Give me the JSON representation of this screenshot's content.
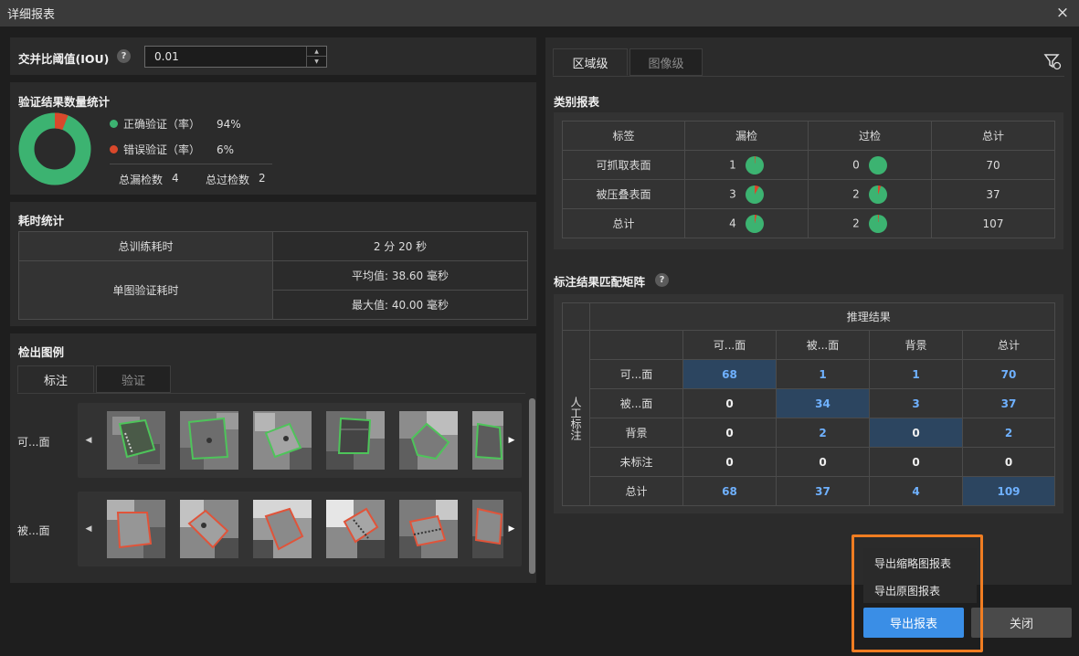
{
  "window": {
    "title": "详细报表",
    "close_icon": "×"
  },
  "iou": {
    "label": "交并比阈值(IOU)",
    "help": "?",
    "value": "0.01"
  },
  "verify_stats": {
    "title": "验证结果数量统计",
    "correct_label": "正确验证（率）",
    "correct_value": "94%",
    "wrong_label": "错误验证（率）",
    "wrong_value": "6%",
    "missed_label": "总漏检数",
    "missed_value": "4",
    "over_label": "总过检数",
    "over_value": "2",
    "colors": {
      "correct": "#3cb371",
      "wrong": "#d9482b"
    },
    "correct_fraction": 0.94
  },
  "time_stats": {
    "title": "耗时统计",
    "train_label": "总训练耗时",
    "train_value": "2 分 20 秒",
    "verify_label": "单图验证耗时",
    "avg": "平均值: 38.60 毫秒",
    "max": "最大值: 40.00 毫秒"
  },
  "examples": {
    "title": "检出图例",
    "tabs": [
      "标注",
      "验证"
    ],
    "rows": [
      {
        "label": "可...面",
        "box_color": "#4ec45a"
      },
      {
        "label": "被...面",
        "box_color": "#e0543a"
      }
    ]
  },
  "right_tabs": [
    "区域级",
    "图像级"
  ],
  "filter_icon": "filter-settings-icon",
  "category_report": {
    "title": "类别报表",
    "headers": [
      "标签",
      "漏检",
      "过检",
      "总计"
    ],
    "rows": [
      {
        "label": "可抓取表面",
        "missed": "1",
        "missed_frac": 0.014,
        "over": "0",
        "over_frac": 0.0,
        "total": "70"
      },
      {
        "label": "被压叠表面",
        "missed": "3",
        "missed_frac": 0.08,
        "over": "2",
        "over_frac": 0.054,
        "total": "37"
      },
      {
        "label": "总计",
        "missed": "4",
        "missed_frac": 0.037,
        "over": "2",
        "over_frac": 0.019,
        "total": "107"
      }
    ]
  },
  "matrix": {
    "title": "标注结果匹配矩阵",
    "help": "?",
    "top_header": "推理结果",
    "side_header": "人工标注",
    "cols": [
      "可...面",
      "被...面",
      "背景",
      "总计"
    ],
    "rows": [
      {
        "label": "可...面",
        "cells": [
          "68",
          "1",
          "1",
          "70"
        ]
      },
      {
        "label": "被...面",
        "cells": [
          "0",
          "34",
          "3",
          "37"
        ]
      },
      {
        "label": "背景",
        "cells": [
          "0",
          "2",
          "0",
          "2"
        ]
      },
      {
        "label": "未标注",
        "cells": [
          "0",
          "0",
          "0",
          "0"
        ]
      },
      {
        "label": "总计",
        "cells": [
          "68",
          "37",
          "4",
          "109"
        ]
      }
    ]
  },
  "export_menu": {
    "items": [
      "导出缩略图报表",
      "导出原图报表"
    ]
  },
  "buttons": {
    "export": "导出报表",
    "close": "关闭"
  }
}
